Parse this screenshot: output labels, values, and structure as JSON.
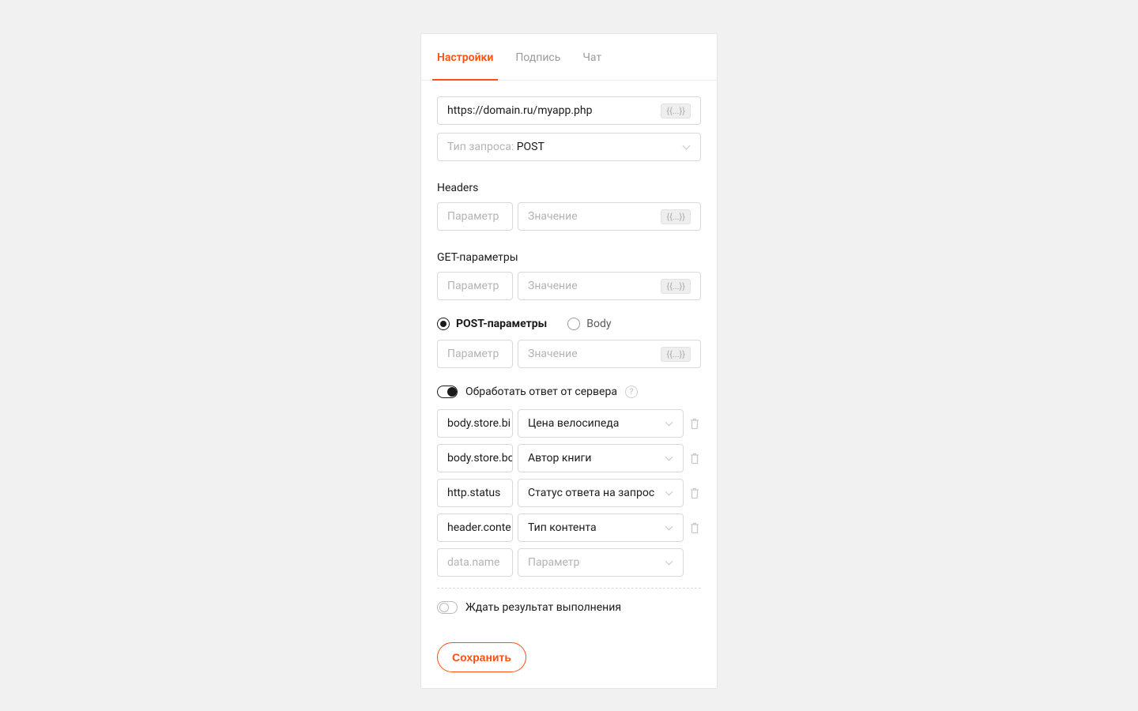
{
  "tabs": {
    "settings": "Настройки",
    "signature": "Подпись",
    "chat": "Чат"
  },
  "url": {
    "value": "https://domain.ru/myapp.php",
    "chip": "{{...}}"
  },
  "requestType": {
    "prefix": "Тип запроса: ",
    "value": "POST"
  },
  "headers": {
    "label": "Headers",
    "paramPlaceholder": "Параметр",
    "valuePlaceholder": "Значение",
    "chip": "{{...}}"
  },
  "getParams": {
    "label": "GET-параметры",
    "paramPlaceholder": "Параметр",
    "valuePlaceholder": "Значение",
    "chip": "{{...}}"
  },
  "bodyMode": {
    "postParams": "POST-параметры",
    "body": "Body",
    "selected": "postParams"
  },
  "postParams": {
    "paramPlaceholder": "Параметр",
    "valuePlaceholder": "Значение",
    "chip": "{{...}}"
  },
  "processResponse": {
    "label": "Обработать ответ от сервера",
    "on": true,
    "rows": [
      {
        "path": "body.store.bi",
        "target": "Цена велосипеда"
      },
      {
        "path": "body.store.bo",
        "target": "Автор книги"
      },
      {
        "path": "http.status",
        "target": "Статус ответа на запрос"
      },
      {
        "path": "header.conte",
        "target": "Тип контента"
      }
    ],
    "emptyRow": {
      "pathPlaceholder": "data.name",
      "targetPlaceholder": "Параметр"
    }
  },
  "waitResult": {
    "label": "Ждать результат выполнения",
    "on": false
  },
  "save": "Сохранить"
}
